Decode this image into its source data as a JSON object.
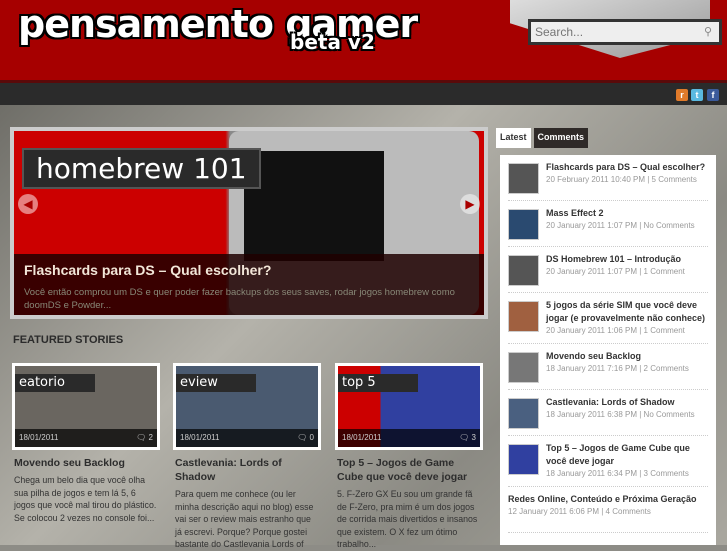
{
  "header": {
    "logo": "pensamento gamer",
    "logo_sub": "beta v2",
    "search_placeholder": "Search..."
  },
  "social": [
    {
      "name": "rss",
      "color": "#e07a2a",
      "glyph": "r"
    },
    {
      "name": "twitter",
      "color": "#5ab9e0",
      "glyph": "t"
    },
    {
      "name": "facebook",
      "color": "#3b5a9a",
      "glyph": "f"
    }
  ],
  "slider": {
    "label": "homebrew 101",
    "title": "Flashcards para DS – Qual escolher?",
    "excerpt": "Você então comprou um DS e quer poder fazer backups dos seus saves, rodar jogos homebrew como doomDS e Powder..."
  },
  "featured": {
    "heading": "FEATURED STORIES",
    "items": [
      {
        "tag": "eatorio",
        "date": "18/01/2011",
        "comments": "2",
        "title": "Movendo seu Backlog",
        "excerpt": "Chega um belo dia que você olha sua pilha de jogos e tem lá 5, 6 jogos que você mal tirou do plástico. Se colocou 2 vezes no console foi...",
        "bg": "#6a6660"
      },
      {
        "tag": "eview",
        "date": "18/01/2011",
        "comments": "0",
        "title": "Castlevania: Lords of Shadow",
        "excerpt": "Para quem me conhece (ou ler minha descrição aqui no blog) esse vai ser o review mais estranho que já escrevi. Porque? Porque gostei bastante do Castlevania Lords of",
        "bg": "#4a5a70"
      },
      {
        "tag": "top 5",
        "date": "18/01/2011",
        "comments": "3",
        "title": "Top 5 – Jogos de Game Cube que você deve jogar",
        "excerpt": "5. F-Zero GX Eu sou um grande fã de F-Zero, pra mim é um dos jogos de corrida mais divertidos e insanos que existem. O X fez um ótimo trabalho...",
        "bg": "#3040a0"
      }
    ]
  },
  "sidebar": {
    "tabs": [
      "Latest",
      "Comments"
    ],
    "items": [
      {
        "title": "Flashcards para DS – Qual escolher?",
        "meta": "20 February 2011 10:40 PM | 5 Comments",
        "thumb": "#555"
      },
      {
        "title": "Mass Effect 2",
        "meta": "20 January 2011 1:07 PM | No Comments",
        "thumb": "#2a4a70"
      },
      {
        "title": "DS Homebrew 101 – Introdução",
        "meta": "20 January 2011 1:07 PM | 1 Comment",
        "thumb": "#555"
      },
      {
        "title": "5 jogos da série SIM que você deve jogar (e provavelmente não conhece)",
        "meta": "20 January 2011 1:06 PM | 1 Comment",
        "thumb": "#a06040"
      },
      {
        "title": "Movendo seu Backlog",
        "meta": "18 January 2011 7:16 PM | 2 Comments",
        "thumb": "#777"
      },
      {
        "title": "Castlevania: Lords of Shadow",
        "meta": "18 January 2011 6:38 PM | No Comments",
        "thumb": "#4a6080"
      },
      {
        "title": "Top 5 – Jogos de Game Cube que você deve jogar",
        "meta": "18 January 2011 6:34 PM | 3 Comments",
        "thumb": "#3040a0"
      },
      {
        "title": "Redes Online, Conteúdo e Próxima Geração",
        "meta": "12 January 2011 6:06 PM | 4 Comments"
      }
    ]
  }
}
